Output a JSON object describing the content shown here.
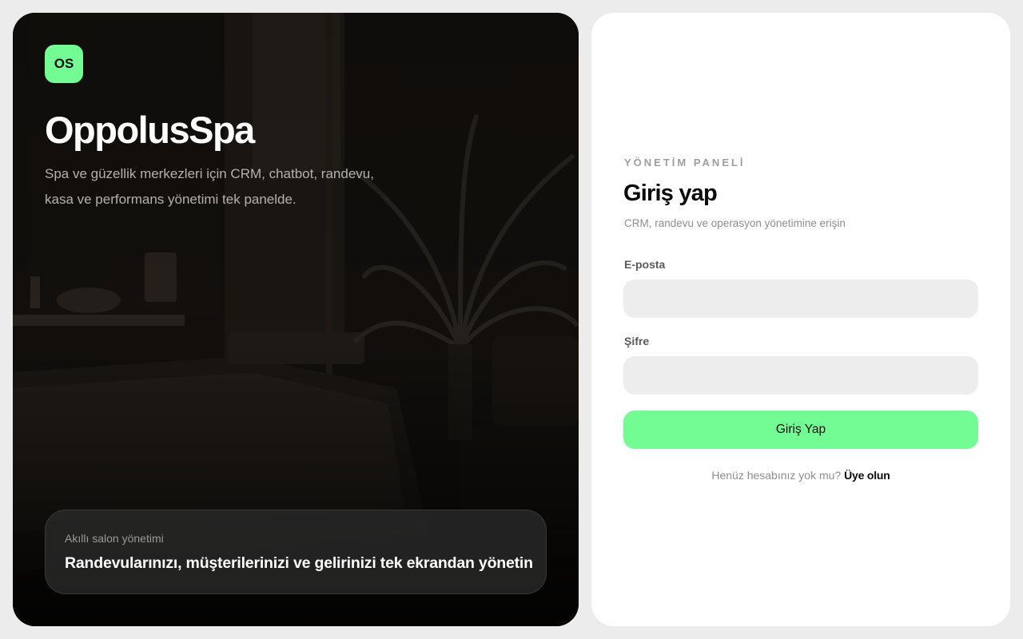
{
  "colors": {
    "accent": "#74fc94",
    "hero_bg": "#0b0a09",
    "card_bg": "#ffffff",
    "page_bg": "#ececec",
    "input_bg": "#ededed"
  },
  "hero": {
    "logo_text": "OS",
    "brand_name": "OppolusSpa",
    "description": "Spa ve güzellik merkezleri için CRM, chatbot, randevu, kasa ve performans yönetimi tek panelde.",
    "background_image": "dimmed spa room with massage bed and palm plant",
    "feature": {
      "kicker": "Akıllı salon yönetimi",
      "headline": "Randevularınızı, müşterilerinizi ve gelirinizi tek ekrandan yönetin"
    }
  },
  "login": {
    "eyebrow": "YÖNETİM PANELİ",
    "title": "Giriş yap",
    "subtitle": "CRM, randevu ve operasyon yönetimine erişin",
    "email": {
      "label": "E-posta",
      "value": "",
      "placeholder": ""
    },
    "password": {
      "label": "Şifre",
      "value": "",
      "placeholder": ""
    },
    "submit_label": "Giriş Yap",
    "signup_prompt": "Henüz hesabınız yok mu?",
    "signup_link": "Üye olun"
  }
}
